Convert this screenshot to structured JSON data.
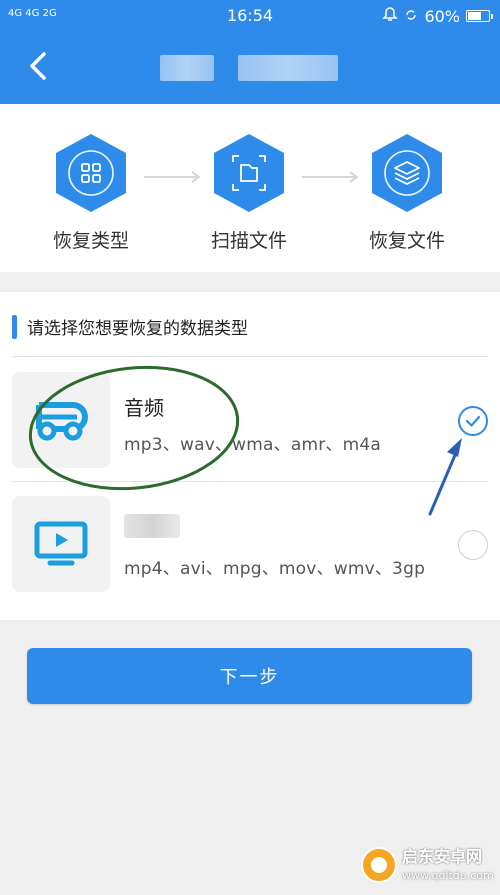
{
  "status_bar": {
    "signal": "4G 4G  2G",
    "time": "16:54",
    "battery": "60%"
  },
  "header": {
    "back_icon": "chevron-left-icon"
  },
  "steps": [
    {
      "label": "恢复类型",
      "icon": "grid-icon"
    },
    {
      "label": "扫描文件",
      "icon": "scan-file-icon"
    },
    {
      "label": "恢复文件",
      "icon": "layers-icon"
    }
  ],
  "section": {
    "title": "请选择您想要恢复的数据类型"
  },
  "types": [
    {
      "name": "音频",
      "formats": "mp3、wav、wma、amr、m4a",
      "icon": "music-icon",
      "selected": true
    },
    {
      "name": "",
      "formats": "mp4、avi、mpg、mov、wmv、3gp",
      "icon": "video-icon",
      "selected": false
    }
  ],
  "next_button": {
    "label": "下一步"
  },
  "watermark": {
    "title": "启东安卓网",
    "url": "www.qdltdu.com"
  },
  "colors": {
    "primary": "#2f8bea",
    "annotation": "#2c6b2c",
    "arrow": "#2a5fb8"
  }
}
